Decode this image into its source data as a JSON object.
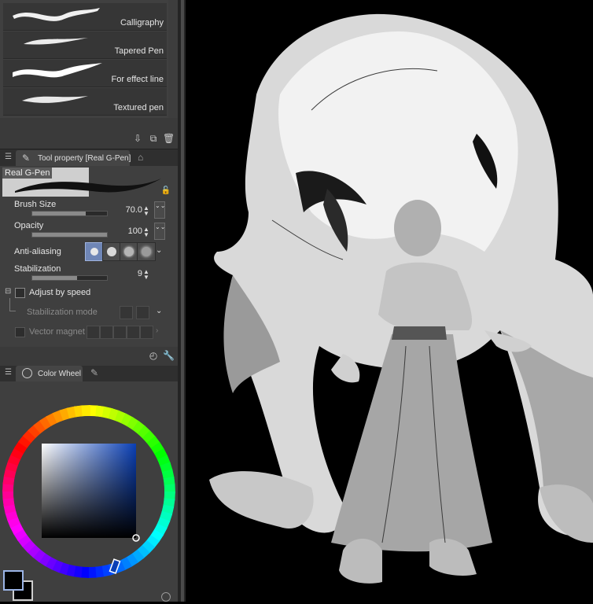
{
  "brush_list": {
    "items": [
      {
        "label": "Calligraphy"
      },
      {
        "label": "Tapered Pen"
      },
      {
        "label": "For effect line"
      },
      {
        "label": "Textured pen"
      }
    ]
  },
  "tool_property": {
    "tab_title": "Tool property [Real G-Pen]",
    "preview_name": "Real G-Pen",
    "brush_size": {
      "label": "Brush Size",
      "value": "70.0",
      "fill": 0.72
    },
    "opacity": {
      "label": "Opacity",
      "value": "100",
      "fill": 1.0
    },
    "anti_aliasing": {
      "label": "Anti-aliasing"
    },
    "stabilization": {
      "label": "Stabilization",
      "value": "9",
      "fill": 0.6
    },
    "adjust_by_speed": {
      "label": "Adjust by speed"
    },
    "stabilization_mode": {
      "label": "Stabilization mode"
    },
    "vector_magnet": {
      "label": "Vector magnet"
    }
  },
  "color_wheel": {
    "tab_title": "Color Wheel",
    "main_color": "#000000",
    "sub_color": "#000000",
    "hue": "#0a3fb5"
  }
}
